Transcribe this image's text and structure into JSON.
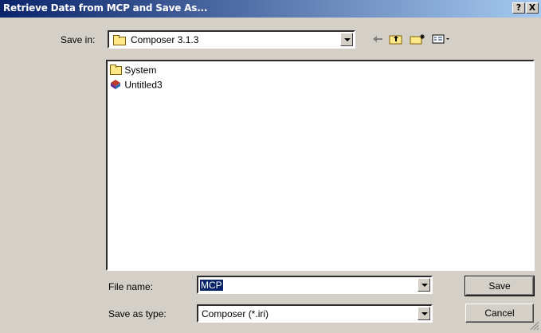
{
  "window": {
    "title": "Retrieve Data from MCP and Save As...",
    "help_glyph": "?",
    "close_glyph": "X"
  },
  "save_in": {
    "label": "Save in:",
    "value": "Composer 3.1.3"
  },
  "toolbar": {
    "back_icon": "back-arrow-icon",
    "up_icon": "up-one-level-icon",
    "new_folder_icon": "new-folder-icon",
    "view_menu_icon": "view-menu-icon"
  },
  "file_list": {
    "items": [
      {
        "label": "System",
        "icon": "folder-icon"
      },
      {
        "label": "Untitled3",
        "icon": "composer-file-icon"
      }
    ]
  },
  "file_name": {
    "label": "File name:",
    "value": "MCP"
  },
  "save_as_type": {
    "label": "Save as type:",
    "value": "Composer (*.iri)"
  },
  "buttons": {
    "save": "Save",
    "cancel": "Cancel"
  },
  "colors": {
    "title_start": "#0a246a",
    "title_end": "#a6caf0",
    "face": "#d4d0c8",
    "selection": "#0a246a"
  }
}
